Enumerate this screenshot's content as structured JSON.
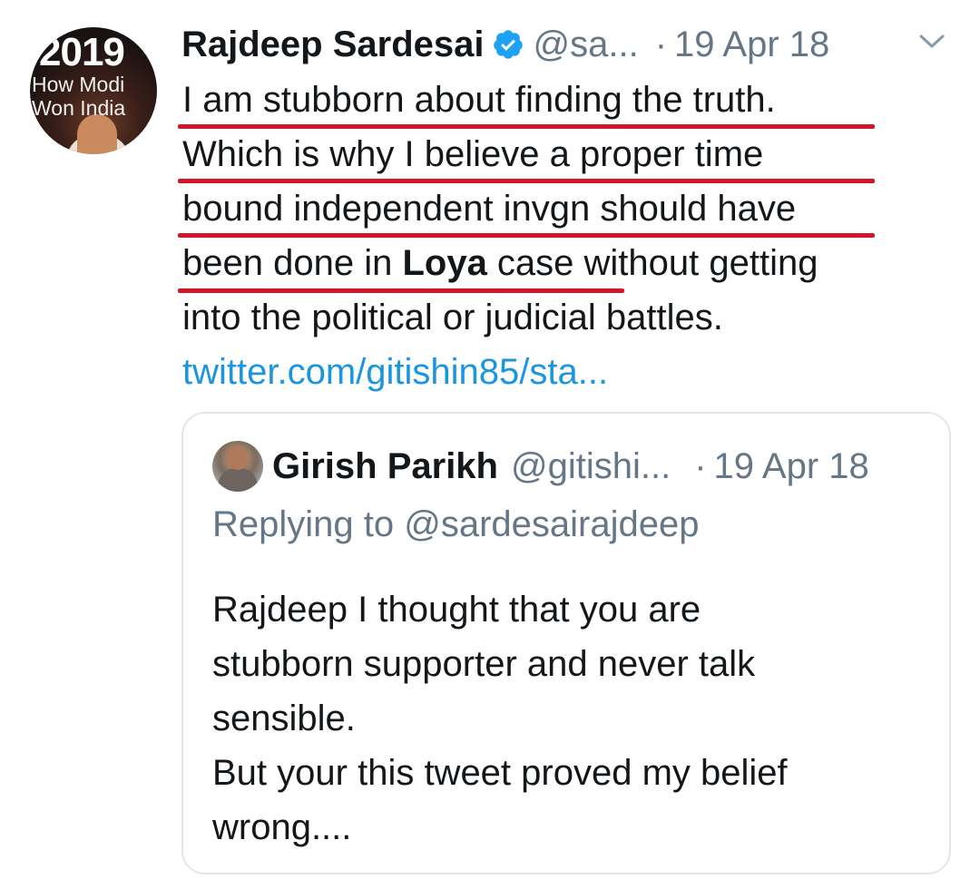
{
  "tweet": {
    "avatar": {
      "year": "2019",
      "line1": "How Modi",
      "line2": "Won India"
    },
    "display_name": "Rajdeep Sardesai",
    "verified": true,
    "handle": "@sa...",
    "separator": "·",
    "date": "19 Apr 18",
    "menu_icon": "chevron-down-icon",
    "body_lines": [
      "I am stubborn about finding the truth.",
      "Which is why I believe a proper time",
      "bound independent invgn should have"
    ],
    "line4_prefix": "been done in ",
    "line4_bold": "Loya",
    "line4_suffix": " case without getting",
    "line5": "into the political or judicial battles.",
    "link": "twitter.com/gitishin85/sta..."
  },
  "quoted": {
    "display_name": "Girish Parikh",
    "handle": "@gitishi...",
    "separator": "·",
    "date": "19 Apr 18",
    "replying_to": "Replying to @sardesairajdeep",
    "body_lines": [
      "Rajdeep I thought that you are",
      "stubborn supporter and never talk",
      "sensible.",
      "But your this tweet proved my belief",
      "wrong...."
    ]
  },
  "colors": {
    "text": "#14171a",
    "secondary": "#657786",
    "link": "#1b95e0",
    "verified": "#1da1f2",
    "annotation_red": "#d0182a",
    "border": "#e1e8ed"
  }
}
